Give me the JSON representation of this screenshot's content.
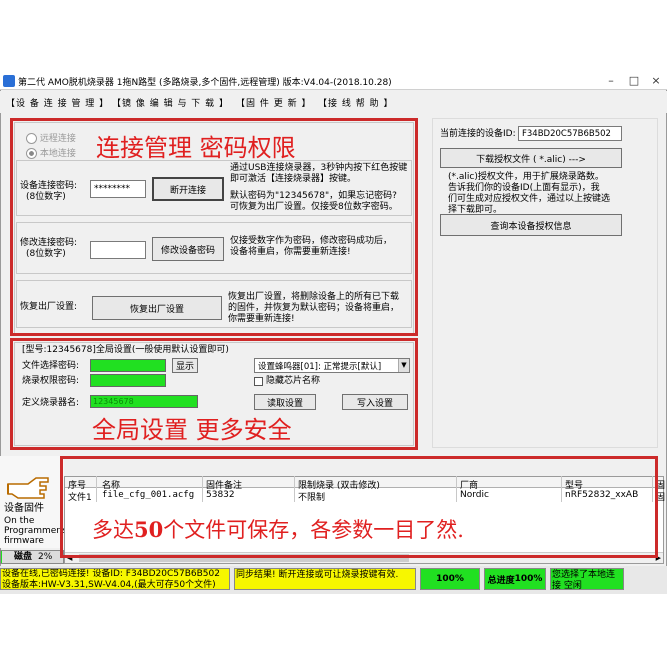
{
  "window": {
    "title": "第二代 AMO脱机烧录器 1拖N路型 (多路烧录,多个固件,远程管理)  版本:V4.04-(2018.10.28)"
  },
  "menu": {
    "items": [
      "【设 备 连 接 管 理 】",
      "【镜 像 编 辑 与 下 载 】",
      "【固 件 更 新 】",
      "【接 线 帮 助 】"
    ]
  },
  "connect": {
    "radio_remote": "远程连接",
    "radio_local": "本地连接",
    "password_label_1": "设备连接密码:",
    "password_label_2": "(8位数字)",
    "password_value": "********",
    "disconnect_button": "断开连接",
    "info_1": "通过USB连接烧录器，3秒钟内按下红色按键",
    "info_2": "即可激活【连接烧录器】按键。",
    "info_3": "默认密码为\"12345678\"，如果忘记密码?",
    "info_4": "可恢复为出厂设置。仅接受8位数字密码。",
    "change_label_1": "修改连接密码:",
    "change_label_2": "(8位数字)",
    "change_button": "修改设备密码",
    "change_info_1": "仅接受数字作为密码，修改密码成功后，",
    "change_info_2": "设备将重启，你需要重新连接!",
    "factory_label": "恢复出厂设置:",
    "factory_button": "恢复出厂设置",
    "factory_info_1": "恢复出厂设置，将删除设备上的所有已下载",
    "factory_info_2": "的固件，并恢复为默认密码；设备将重启，",
    "factory_info_3": "你需要重新连接!"
  },
  "overlay": {
    "connect_caption": "连接管理  密码权限",
    "global_caption": "全局设置  更多安全",
    "files_caption_a": "多达",
    "files_caption_num": "50",
    "files_caption_b": "个文件可保存，各参数一目了然."
  },
  "global": {
    "group_title": "[型号:12345678]全局设置(一般使用默认设置即可)",
    "file_pw_label": "文件选择密码:",
    "burn_pw_label": "烧录权限密码:",
    "show_button": "显示",
    "name_label": "定义烧录器名:",
    "name_value": "12345678",
    "buzzer_select": "设置蜂鸣器[01]: 正常提示[默认]",
    "hide_chip_label": "隐藏芯片名称",
    "read_button": "读取设置",
    "write_button": "写入设置"
  },
  "right": {
    "device_id_label": "当前连接的设备ID:",
    "device_id_value": "F34BD20C57B6B502",
    "download_button": "下载授权文件 ( *.alic)  --->",
    "auth_info_1": "(*.alic)授权文件，用于扩展烧录路数。",
    "auth_info_2": "告诉我们你的设备ID(上面有显示)，我",
    "auth_info_3": "们可生成对应授权文件，通过以上按键选",
    "auth_info_4": "择下载即可。",
    "query_button": "查询本设备授权信息"
  },
  "firmware_panel": {
    "label_cn": "设备固件",
    "label_en_1": "On the",
    "label_en_2": "Programmer's",
    "label_en_3": "firmware"
  },
  "disk": {
    "label": "磁盘",
    "percent": "2%",
    "fill_fraction": 0.02
  },
  "table": {
    "columns": [
      "序号",
      "名称",
      "固件备注",
      "限制烧录 (双击修改)",
      "厂商",
      "型号",
      "固"
    ],
    "rows": [
      [
        "文件1",
        "file_cfg_001.acfg",
        "53832",
        "不限制",
        "Nordic",
        "nRF52832_xxAB",
        "固"
      ]
    ]
  },
  "status": {
    "left_line_1": "设备在线,已密码连接! 设备ID: F34BD20C57B6B502",
    "left_line_2": "设备版本:HW-V3.31,SW-V4.04,(最大可存50个文件)",
    "sync_text": "同步结果! 断开连接或可让烧录按键有效.",
    "percent_1": "100%",
    "total_label": "总进度",
    "percent_2": "100%",
    "right_text": "您选择了本地连接 空闲"
  },
  "colors": {
    "accent_red": "#cc2a2a",
    "progress_green": "#21e021",
    "status_yellow": "#f7f700"
  }
}
